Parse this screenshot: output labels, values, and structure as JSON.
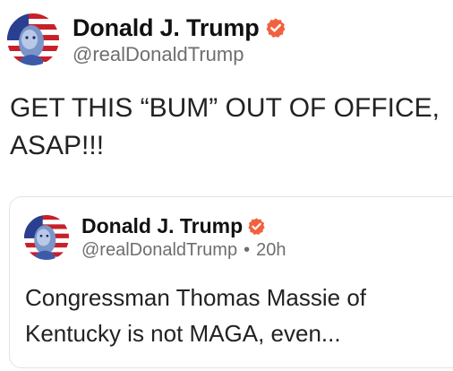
{
  "post": {
    "author": {
      "display_name": "Donald J. Trump",
      "handle": "@realDonaldTrump",
      "avatar_icon": "avatar-flag-portrait",
      "verified_icon": "verified-badge-icon"
    },
    "text": "GET THIS “BUM” OUT OF OFFICE,\nASAP!!!"
  },
  "quote": {
    "author": {
      "display_name": "Donald J. Trump",
      "handle": "@realDonaldTrump",
      "separator": "•",
      "time": "20h"
    },
    "text": "Congressman Thomas Massie of Kentucky is not MAGA, even..."
  },
  "colors": {
    "verified": "#f2613f",
    "text": "#222222",
    "muted": "#6e6e6e",
    "border": "#e3e3e3"
  }
}
